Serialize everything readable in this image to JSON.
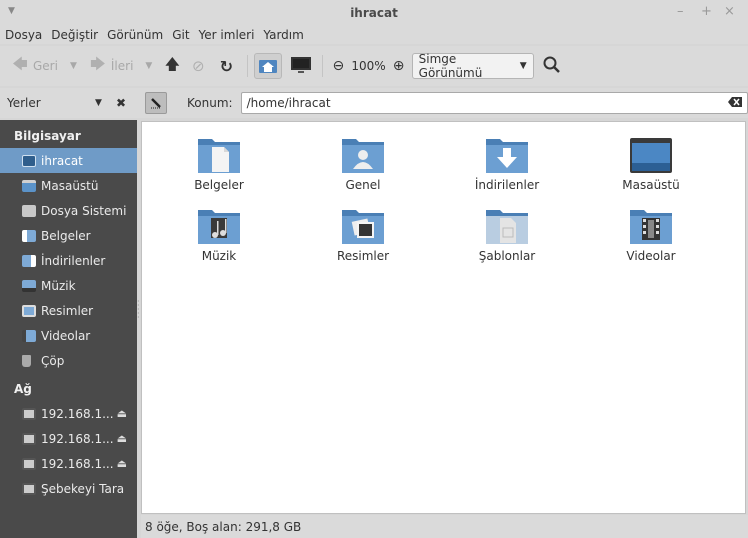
{
  "window": {
    "title": "ihracat",
    "controls": [
      "–",
      "+",
      "×"
    ]
  },
  "menubar": [
    "Dosya",
    "Değiştir",
    "Görünüm",
    "Git",
    "Yer imleri",
    "Yardım"
  ],
  "toolbar": {
    "back_label": "Geri",
    "forward_label": "İleri",
    "zoom_level": "100%",
    "view_mode": "Simge Görünümü"
  },
  "location": {
    "places_label": "Yerler",
    "konum_label": "Konum:",
    "path": "/home/ihracat"
  },
  "sidebar": {
    "computer_heading": "Bilgisayar",
    "computer_items": [
      {
        "label": "ihracat",
        "icon": "home-folder-icon",
        "active": true
      },
      {
        "label": "Masaüstü",
        "icon": "desktop-icon",
        "active": false
      },
      {
        "label": "Dosya Sistemi",
        "icon": "drive-icon",
        "active": false
      },
      {
        "label": "Belgeler",
        "icon": "documents-folder-icon",
        "active": false
      },
      {
        "label": "İndirilenler",
        "icon": "downloads-folder-icon",
        "active": false
      },
      {
        "label": "Müzik",
        "icon": "music-folder-icon",
        "active": false
      },
      {
        "label": "Resimler",
        "icon": "pictures-folder-icon",
        "active": false
      },
      {
        "label": "Videolar",
        "icon": "videos-folder-icon",
        "active": false
      },
      {
        "label": "Çöp",
        "icon": "trash-icon",
        "active": false
      }
    ],
    "network_heading": "Ağ",
    "network_items": [
      {
        "label": "192.168.1...",
        "icon": "network-share-icon"
      },
      {
        "label": "192.168.1...",
        "icon": "network-share-icon"
      },
      {
        "label": "192.168.1...",
        "icon": "network-share-icon"
      },
      {
        "label": "Şebekeyi Tara",
        "icon": "network-browse-icon"
      }
    ]
  },
  "files": [
    {
      "label": "Belgeler",
      "icon": "documents-folder-icon"
    },
    {
      "label": "Genel",
      "icon": "public-folder-icon"
    },
    {
      "label": "İndirilenler",
      "icon": "downloads-folder-icon"
    },
    {
      "label": "Masaüstü",
      "icon": "desktop-folder-icon"
    },
    {
      "label": "Müzik",
      "icon": "music-folder-icon"
    },
    {
      "label": "Resimler",
      "icon": "pictures-folder-icon"
    },
    {
      "label": "Şablonlar",
      "icon": "templates-folder-icon"
    },
    {
      "label": "Videolar",
      "icon": "videos-folder-icon"
    }
  ],
  "status": {
    "text": "8 öğe, Boş alan: 291,8 GB"
  },
  "colors": {
    "accent": "#6f9bc7",
    "sidebar_bg": "#4a4a4a",
    "folder": "#5b93c9"
  }
}
